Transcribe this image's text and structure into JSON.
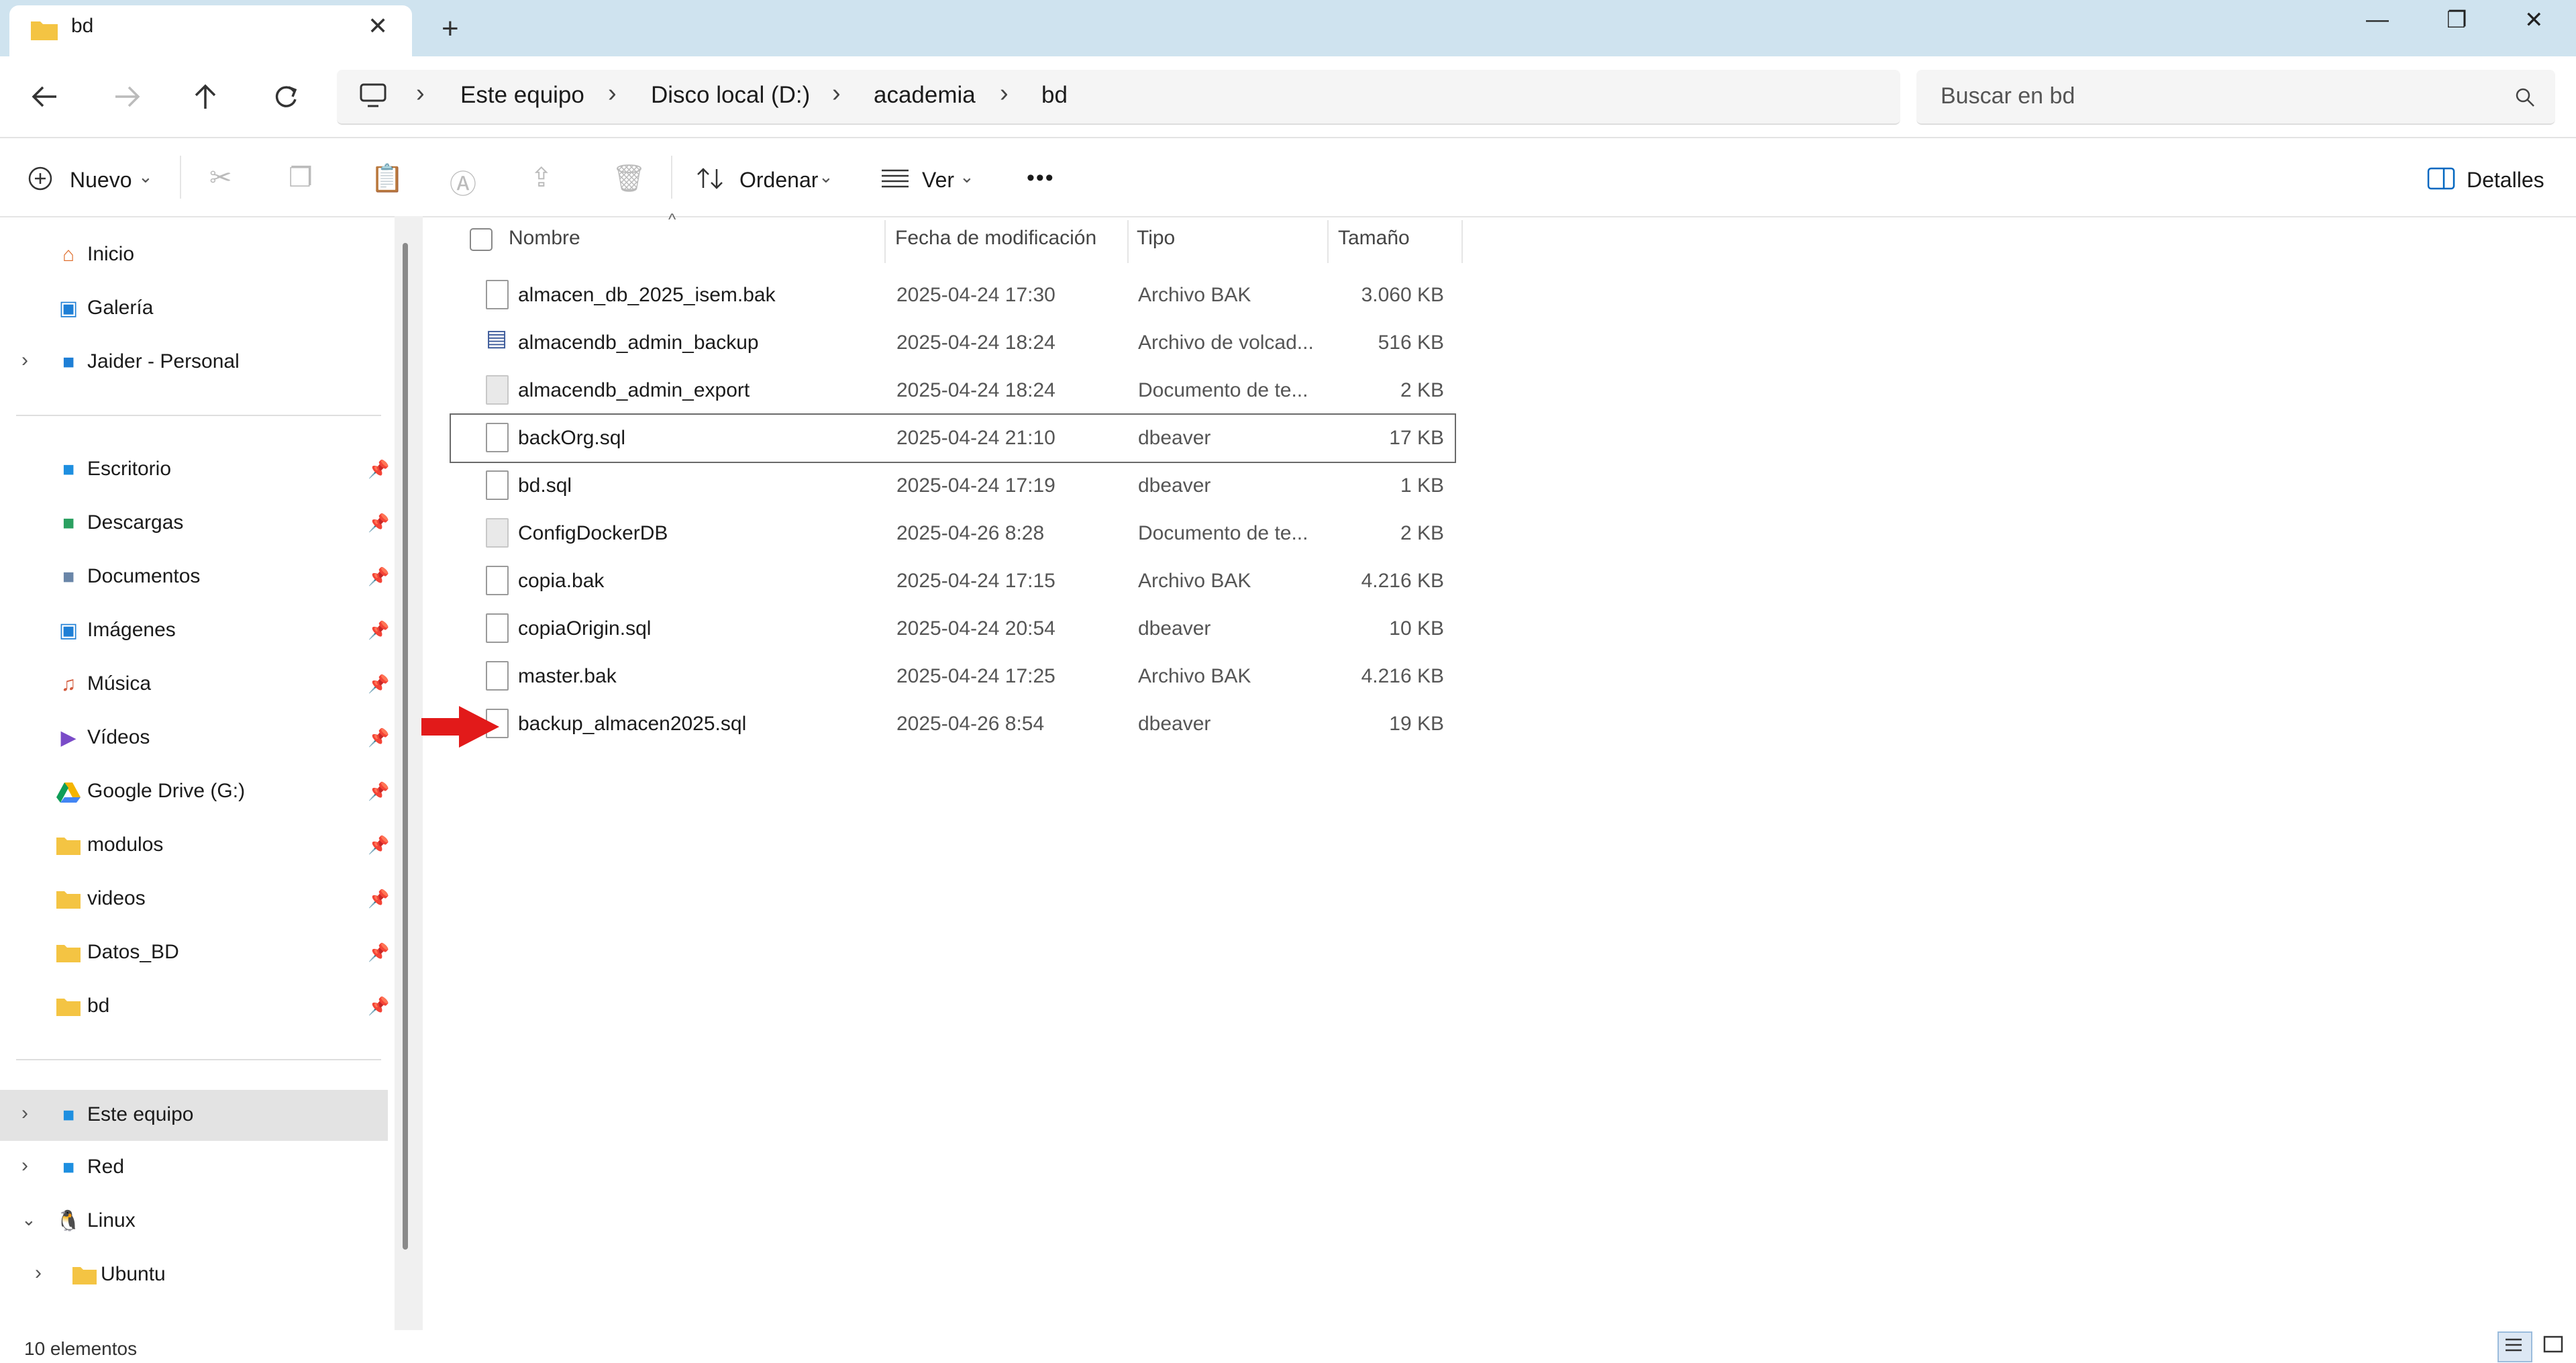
{
  "window": {
    "tab_title": "bd",
    "tab_close": "✕",
    "new_tab": "+",
    "minimize": "—",
    "maximize": "❐",
    "close": "✕"
  },
  "nav": {
    "back_icon": "arrow-left",
    "forward_icon": "arrow-right",
    "up_icon": "arrow-up",
    "refresh_icon": "refresh",
    "breadcrumbs": [
      "Este equipo",
      "Disco local (D:)",
      "academia",
      "bd"
    ],
    "search_placeholder": "Buscar en bd"
  },
  "commands": {
    "new": "Nuevo",
    "sort": "Ordenar",
    "view": "Ver",
    "more": "•••",
    "details": "Detalles"
  },
  "sidebar": {
    "top": [
      {
        "label": "Inicio",
        "icon": "home-icon"
      },
      {
        "label": "Galería",
        "icon": "gallery-icon"
      },
      {
        "label": "Jaider - Personal",
        "icon": "onedrive-folder-icon"
      }
    ],
    "pinned": [
      {
        "label": "Escritorio",
        "icon": "desktop-icon"
      },
      {
        "label": "Descargas",
        "icon": "downloads-icon"
      },
      {
        "label": "Documentos",
        "icon": "documents-icon"
      },
      {
        "label": "Imágenes",
        "icon": "pictures-icon"
      },
      {
        "label": "Música",
        "icon": "music-icon"
      },
      {
        "label": "Vídeos",
        "icon": "videos-icon"
      },
      {
        "label": "Google Drive (G:)",
        "icon": "google-drive-icon"
      },
      {
        "label": "modulos",
        "icon": "folder-icon"
      },
      {
        "label": "videos",
        "icon": "folder-icon"
      },
      {
        "label": "Datos_BD",
        "icon": "folder-icon"
      },
      {
        "label": "bd",
        "icon": "folder-icon"
      }
    ],
    "bottom": [
      {
        "label": "Este equipo",
        "icon": "computer-icon"
      },
      {
        "label": "Red",
        "icon": "network-icon"
      },
      {
        "label": "Linux",
        "icon": "linux-icon"
      },
      {
        "label": "Ubuntu",
        "icon": "folder-icon"
      }
    ]
  },
  "list": {
    "headers": {
      "name": "Nombre",
      "date": "Fecha de modificación",
      "type": "Tipo",
      "size": "Tamaño"
    },
    "files": [
      {
        "name": "almacen_db_2025_isem.bak",
        "date": "2025-04-24 17:30",
        "type": "Archivo BAK",
        "size": "3.060 KB"
      },
      {
        "name": "almacendb_admin_backup",
        "date": "2025-04-24 18:24",
        "type": "Archivo de volcad...",
        "size": "516 KB"
      },
      {
        "name": "almacendb_admin_export",
        "date": "2025-04-24 18:24",
        "type": "Documento de te...",
        "size": "2 KB"
      },
      {
        "name": "backOrg.sql",
        "date": "2025-04-24 21:10",
        "type": "dbeaver",
        "size": "17 KB"
      },
      {
        "name": "bd.sql",
        "date": "2025-04-24 17:19",
        "type": "dbeaver",
        "size": "1 KB"
      },
      {
        "name": "ConfigDockerDB",
        "date": "2025-04-26 8:28",
        "type": "Documento de te...",
        "size": "2 KB"
      },
      {
        "name": "copia.bak",
        "date": "2025-04-24 17:15",
        "type": "Archivo BAK",
        "size": "4.216 KB"
      },
      {
        "name": "copiaOrigin.sql",
        "date": "2025-04-24 20:54",
        "type": "dbeaver",
        "size": "10 KB"
      },
      {
        "name": "master.bak",
        "date": "2025-04-24 17:25",
        "type": "Archivo BAK",
        "size": "4.216 KB"
      },
      {
        "name": "backup_almacen2025.sql",
        "date": "2025-04-26 8:54",
        "type": "dbeaver",
        "size": "19 KB"
      }
    ]
  },
  "status": {
    "count": "10 elementos"
  },
  "colors": {
    "accent": "#0067c0",
    "folder": "#f4c443",
    "arrow": "#e21a1a",
    "titlebar": "#cfe3ef"
  }
}
